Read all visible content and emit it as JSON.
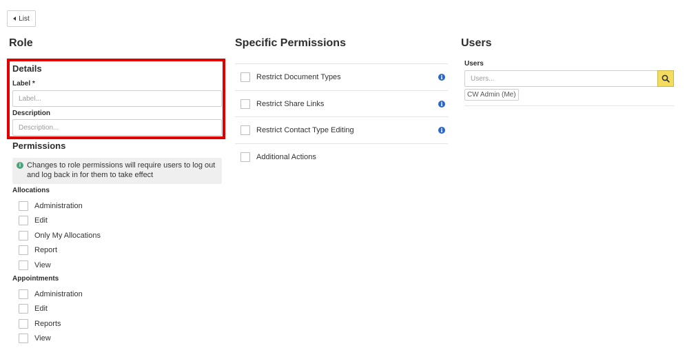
{
  "nav": {
    "back_label": "List"
  },
  "role": {
    "heading": "Role",
    "details": {
      "heading": "Details",
      "label_field": {
        "label": "Label *",
        "placeholder": "Label...",
        "value": ""
      },
      "description_field": {
        "label": "Description",
        "placeholder": "Description...",
        "value": ""
      }
    },
    "permissions": {
      "heading": "Permissions",
      "notice": "Changes to role permissions will require users to log out and log back in for them to take effect",
      "groups": [
        {
          "name": "Allocations",
          "items": [
            "Administration",
            "Edit",
            "Only My Allocations",
            "Report",
            "View"
          ]
        },
        {
          "name": "Appointments",
          "items": [
            "Administration",
            "Edit",
            "Reports",
            "View"
          ]
        }
      ]
    }
  },
  "specific_permissions": {
    "heading": "Specific Permissions",
    "items": [
      {
        "label": "Restrict Document Types",
        "info": true
      },
      {
        "label": "Restrict Share Links",
        "info": true
      },
      {
        "label": "Restrict Contact Type Editing",
        "info": true
      },
      {
        "label": "Additional Actions",
        "info": false
      }
    ]
  },
  "users": {
    "heading": "Users",
    "field_label": "Users",
    "placeholder": "Users...",
    "selected": [
      "CW Admin (Me)"
    ]
  },
  "colors": {
    "highlight": "#e00000",
    "search_button": "#f3dc5e",
    "info_blue": "#2b66c3",
    "info_green": "#4aa37a"
  },
  "icons": [
    "caret-left-icon",
    "info-icon",
    "search-icon"
  ]
}
